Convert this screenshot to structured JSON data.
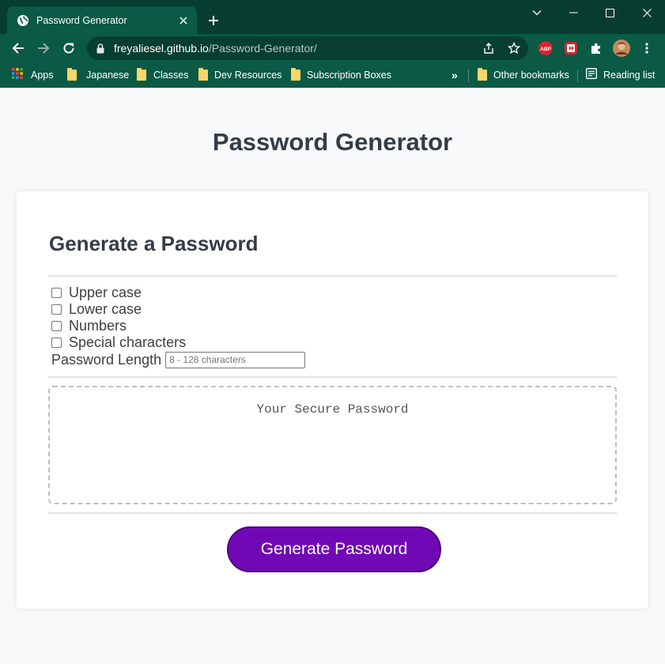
{
  "browser": {
    "tab": {
      "title": "Password Generator",
      "favicon": "globe-icon"
    },
    "address": {
      "domain": "freyaliesel.github.io",
      "path": "/Password-Generator/"
    },
    "bookmarks": [
      {
        "label": "Apps",
        "icon": "apps-grid-icon"
      },
      {
        "label": "Japanese",
        "icon": "folder-icon"
      },
      {
        "label": "Classes",
        "icon": "folder-icon"
      },
      {
        "label": "Dev Resources",
        "icon": "folder-icon"
      },
      {
        "label": "Subscription Boxes",
        "icon": "folder-icon"
      }
    ],
    "overflow_label": "»",
    "other_bookmarks": "Other bookmarks",
    "reading_list": "Reading list",
    "colors": {
      "frame": "#073d2f",
      "toolbar": "#0a5a45",
      "omnibox": "#063e30"
    }
  },
  "page": {
    "title": "Password Generator",
    "card": {
      "heading": "Generate a Password",
      "options": [
        {
          "label": "Upper case",
          "checked": false
        },
        {
          "label": "Lower case",
          "checked": false
        },
        {
          "label": "Numbers",
          "checked": false
        },
        {
          "label": "Special characters",
          "checked": false
        }
      ],
      "length_label": "Password Length",
      "length_placeholder": "8 - 128 characters",
      "output_placeholder": "Your Secure Password",
      "generate_label": "Generate Password"
    },
    "colors": {
      "accent": "#7108b6",
      "text": "#333d47"
    }
  }
}
